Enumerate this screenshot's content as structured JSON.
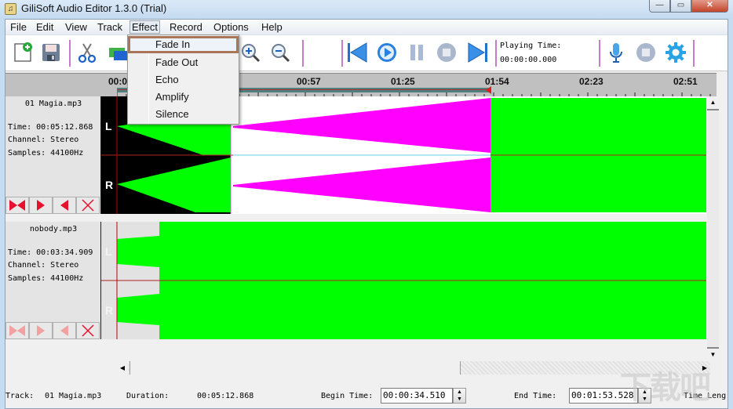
{
  "window": {
    "title": "GiliSoft Audio Editor 1.3.0 (Trial)",
    "controls": {
      "minimize": "—",
      "maximize": "▭",
      "close": "✕"
    }
  },
  "menubar": {
    "items": [
      "File",
      "Edit",
      "View",
      "Track",
      "Effect",
      "Record",
      "Options",
      "Help"
    ],
    "open_menu": "Effect"
  },
  "effect_menu": {
    "items": [
      "Fade In",
      "Fade Out",
      "Echo",
      "Amplify",
      "Silence"
    ],
    "highlighted": "Fade In"
  },
  "toolbar": {
    "icons": [
      "new-file-icon",
      "save-icon",
      "cut-icon",
      "open-folder-icon",
      "zoom-in-icon",
      "zoom-out-icon",
      "skip-back-icon",
      "play-icon",
      "pause-icon",
      "stop-icon",
      "skip-forward-icon",
      "microphone-icon",
      "record-stop-icon",
      "settings-icon"
    ],
    "playing_time_label": "Playing Time:",
    "playing_time_value": "00:00:00.000"
  },
  "ruler": {
    "labels": [
      "00:0",
      "00:57",
      "01:25",
      "01:54",
      "02:23",
      "02:51"
    ],
    "selection_start": "00:00:34.510",
    "selection_end": "00:01:53.528"
  },
  "tracks": [
    {
      "name": "01 Magia.mp3",
      "time": "Time: 00:05:12.868",
      "channel": "Channel: Stereo",
      "samples": "Samples: 44100Hz",
      "channels": [
        "L",
        "R"
      ],
      "active": true
    },
    {
      "name": "nobody.mp3",
      "time": "Time: 00:03:34.909",
      "channel": "Channel: Stereo",
      "samples": "Samples: 44100Hz",
      "channels": [
        "L",
        "R"
      ],
      "active": false
    }
  ],
  "track_buttons": [
    "select-all-icon",
    "select-right-icon",
    "select-left-icon",
    "delete-track-icon"
  ],
  "colors": {
    "waveform": "#00ff00",
    "fade_preview": "#ff00ff",
    "selection_bar": "#4f7f7f",
    "cursor": "#c00000",
    "menu_highlight_border": "#a9765a"
  },
  "statusbar": {
    "track_label": "Track:",
    "track_value": "01 Magia.mp3",
    "duration_label": "Duration:",
    "duration_value": "00:05:12.868",
    "begin_label": "Begin Time:",
    "begin_value": "00:00:34.510",
    "end_label": "End Time:",
    "end_value": "00:01:53.528",
    "length_label": "Time Leng"
  },
  "watermark": "下载吧"
}
